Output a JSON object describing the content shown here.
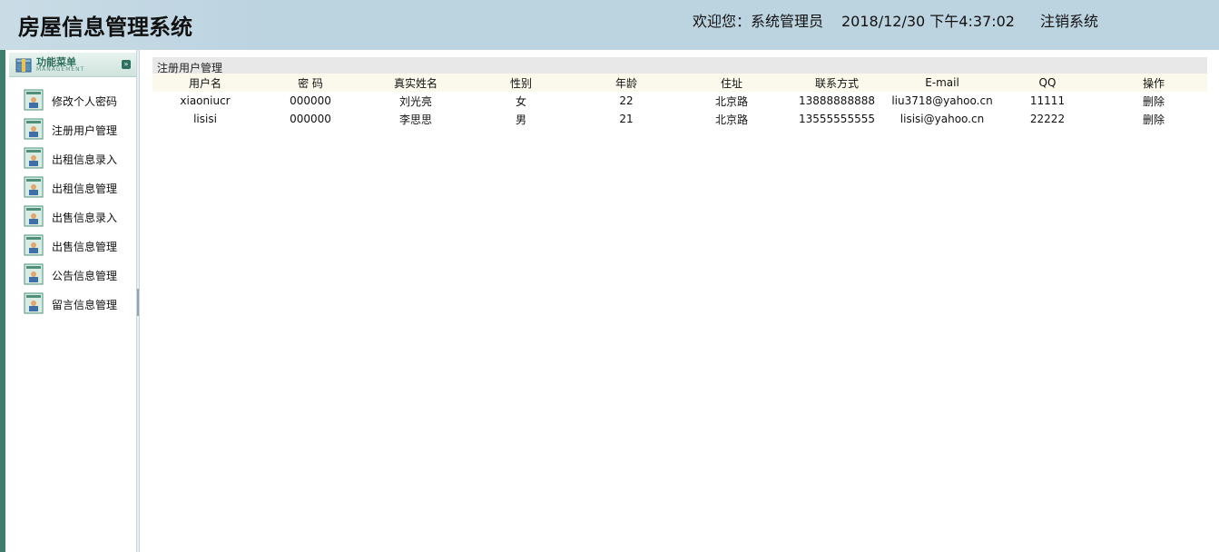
{
  "header": {
    "title": "房屋信息管理系统",
    "welcome": "欢迎您：系统管理员",
    "datetime": "2018/12/30 下午4:37:02",
    "logout": "注销系统"
  },
  "sidebar": {
    "menu_title": "功能菜单",
    "menu_subtitle": "MANAGEMENT",
    "items": [
      {
        "label": "修改个人密码"
      },
      {
        "label": "注册用户管理"
      },
      {
        "label": "出租信息录入"
      },
      {
        "label": "出租信息管理"
      },
      {
        "label": "出售信息录入"
      },
      {
        "label": "出售信息管理"
      },
      {
        "label": "公告信息管理"
      },
      {
        "label": "留言信息管理"
      }
    ]
  },
  "main": {
    "panel_title": "注册用户管理",
    "columns": [
      "用户名",
      "密 码",
      "真实姓名",
      "性别",
      "年龄",
      "住址",
      "联系方式",
      "E-mail",
      "QQ",
      "操作"
    ],
    "rows": [
      [
        "xiaoniucr",
        "000000",
        "刘光亮",
        "女",
        "22",
        "北京路",
        "13888888888",
        "liu3718@yahoo.cn",
        "11111",
        "删除"
      ],
      [
        "lisisi",
        "000000",
        "李思思",
        "男",
        "21",
        "北京路",
        "13555555555",
        "lisisi@yahoo.cn",
        "22222",
        "删除"
      ]
    ]
  },
  "colors": {
    "header_bg": "#bcd3e0",
    "sidebar_accent": "#3e7d6e",
    "table_header_bg": "#fbf9ec",
    "panel_title_bg": "#e8e8e8"
  },
  "icons": {
    "menu_header": "package-icon",
    "collapse": "chevron-down-icon",
    "menu_item": "user-card-icon"
  }
}
